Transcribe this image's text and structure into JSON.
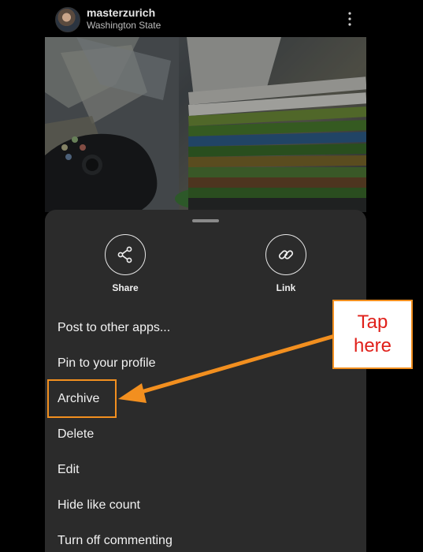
{
  "post": {
    "username": "masterzurich",
    "location": "Washington State"
  },
  "sheet": {
    "share_label": "Share",
    "link_label": "Link",
    "menu": [
      "Post to other apps...",
      "Pin to your profile",
      "Archive",
      "Delete",
      "Edit",
      "Hide like count",
      "Turn off commenting"
    ]
  },
  "annotation": {
    "line1": "Tap",
    "line2": "here",
    "border_color": "#f28f1f",
    "text_color": "#e0201a"
  },
  "icons": {
    "more": "vertical-ellipsis-icon",
    "share": "share-icon",
    "link": "link-icon"
  }
}
